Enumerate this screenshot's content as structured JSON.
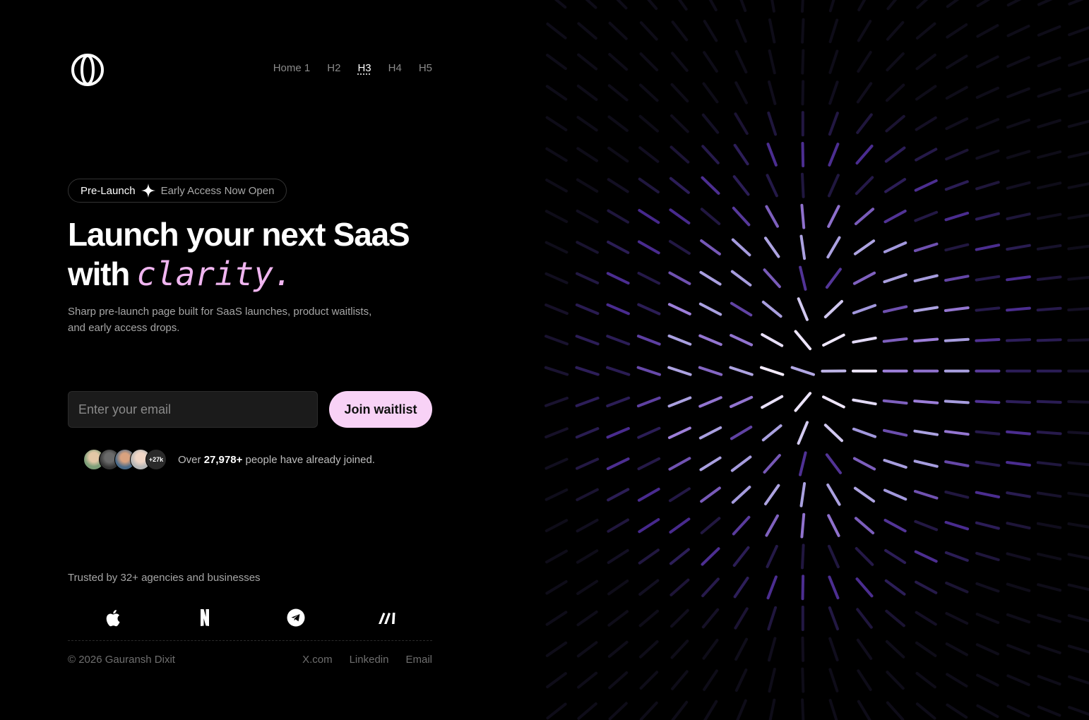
{
  "nav": {
    "items": [
      {
        "label": "Home 1",
        "active": false
      },
      {
        "label": "H2",
        "active": false
      },
      {
        "label": "H3",
        "active": true
      },
      {
        "label": "H4",
        "active": false
      },
      {
        "label": "H5",
        "active": false
      }
    ]
  },
  "badge": {
    "label": "Pre-Launch",
    "text": "Early Access Now Open"
  },
  "hero": {
    "title_line1": "Launch your next SaaS",
    "title_line2": "with",
    "title_accent": "clarity.",
    "subtitle": "Sharp pre-launch page built for SaaS launches, product waitlists, and early access drops."
  },
  "form": {
    "email_placeholder": "Enter your email",
    "button_label": "Join waitlist"
  },
  "social_proof": {
    "avatar_more": "+27k",
    "prefix": "Over",
    "count": "27,978+",
    "suffix": "people have already joined."
  },
  "trusted": {
    "text": "Trusted by 32+ agencies and businesses",
    "brands": [
      "apple-icon",
      "netflix-icon",
      "telegram-icon",
      "make-icon"
    ]
  },
  "footer": {
    "copyright": "© 2026 Gauransh Dixit",
    "links": [
      "X.com",
      "Linkedin",
      "Email"
    ]
  },
  "colors": {
    "accent": "#f8d2f6",
    "accent_text": "#f0b5f0",
    "background": "#000000"
  }
}
